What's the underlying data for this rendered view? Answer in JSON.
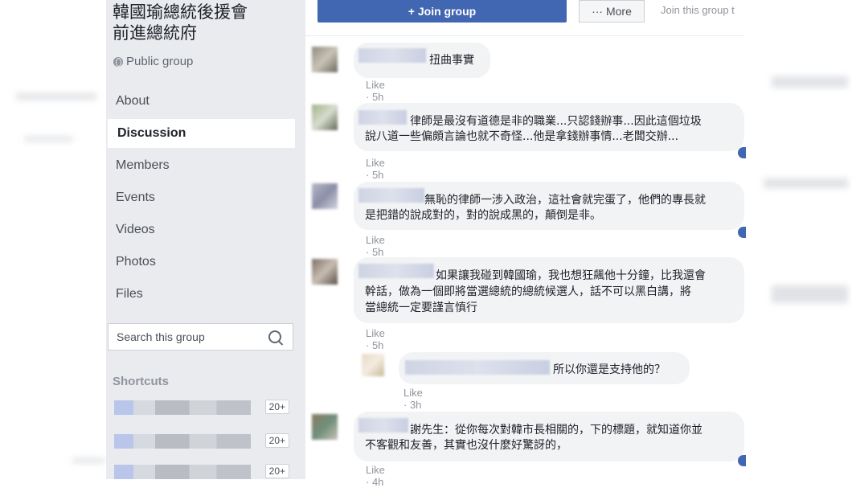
{
  "group": {
    "name_line1": "韓國瑜總統後援會",
    "name_line2": "前進總統府",
    "privacy": "Public group"
  },
  "nav": [
    "About",
    "Discussion",
    "Members",
    "Events",
    "Videos",
    "Photos",
    "Files"
  ],
  "search": {
    "placeholder": "Search this group"
  },
  "shortcuts": {
    "title": "Shortcuts",
    "badges": [
      "20+",
      "20+",
      "20+"
    ]
  },
  "actions": {
    "join": "+ Join group",
    "more": "··· More",
    "hint": "Join this group t"
  },
  "comments": [
    {
      "lines": [
        "扭曲事實"
      ],
      "meta": "Like · 5h"
    },
    {
      "lines": [
        "律師是最沒有道德是非的職業...只認錢辦事...因此這個垃圾",
        "說八道一些偏頗言論也就不奇怪...他是拿錢辦事情...老闆交辦..."
      ],
      "meta": "Like · 5h"
    },
    {
      "lines": [
        "無恥的律師一涉入政治，這社會就完蛋了，他們的專長就",
        "是把錯的說成對的，對的說成黑的，顛倒是非。"
      ],
      "meta": "Like · 5h"
    },
    {
      "lines": [
        "如果讓我碰到韓國瑜，我也想狂飆他十分鐘，比我還會",
        "幹話，做為一個即將當選總統的總統候選人，話不可以黑白講，將",
        "當總統一定要謹言慎行"
      ],
      "meta": "Like · 5h"
    },
    {
      "lines": [
        "所以你還是支持他的？"
      ],
      "meta": "Like · 3h"
    },
    {
      "lines": [
        "謝先生：從你每次對韓市長相關的，下的標題，就知道你並",
        "不客觀和友善，其實也沒什麼好驚訝的，"
      ],
      "meta": "Like · 4h"
    }
  ]
}
